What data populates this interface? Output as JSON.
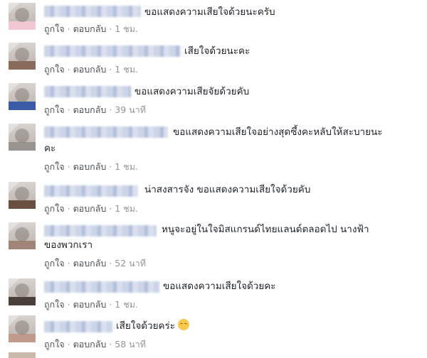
{
  "actions": {
    "like": "ถูกใจ",
    "reply": "ตอบกลับ"
  },
  "comments": [
    {
      "text": "ขอแสดงความเสียใจด้วยนะครับ",
      "time": "1 ชม."
    },
    {
      "text": "เสียใจด้วยนะคะ",
      "time": "1 ชม."
    },
    {
      "text": "ขอแสดงความเสียจัยด้วยคับ",
      "time": "39 นาที"
    },
    {
      "text": "ขอแสดงความเสียใจอย่างสุดซึ้งคะหลับให้สะบายนะ",
      "text2": "คะ",
      "time": "1 ชม."
    },
    {
      "text": "น่าสงสารจัง ขอแสดงความเสียใจด้วยคับ",
      "time": "1 ชม."
    },
    {
      "text": "หนูจะอยู่ในใจมิสแกรนด์ไทยแลนด์ตลอดไป นางฟ้า",
      "text2": "ของพวกเรา",
      "time": "52 นาที"
    },
    {
      "text": "ขอแสดงความเสียใจด้วยคะ",
      "time": "1 ชม."
    },
    {
      "text": "เสียใจด้วยคร่ะ",
      "emoji": "pensive-face",
      "time": "58 นาที"
    }
  ]
}
